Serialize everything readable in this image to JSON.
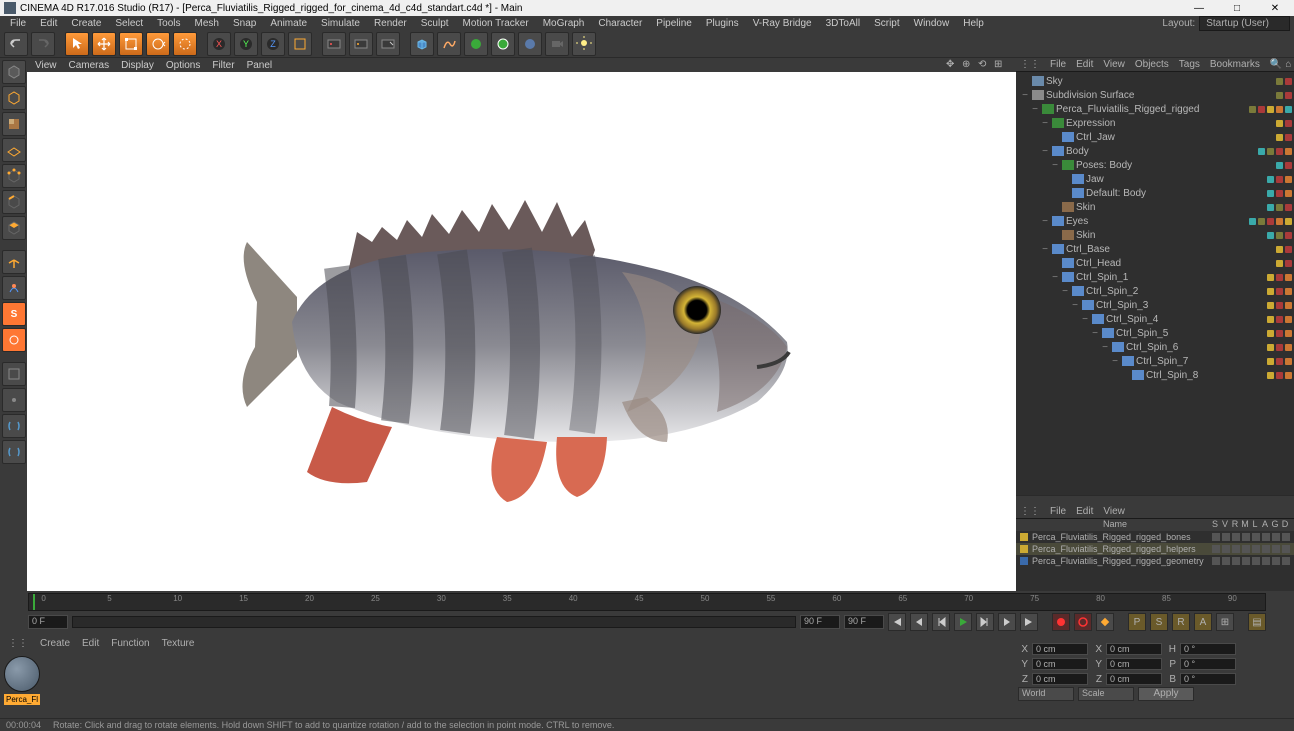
{
  "window": {
    "title": "CINEMA 4D R17.016 Studio (R17) - [Perca_Fluviatilis_Rigged_rigged_for_cinema_4d_c4d_standart.c4d *] - Main",
    "min": "—",
    "max": "□",
    "close": "✕"
  },
  "menu": {
    "items": [
      "File",
      "Edit",
      "Create",
      "Select",
      "Tools",
      "Mesh",
      "Snap",
      "Animate",
      "Simulate",
      "Render",
      "Sculpt",
      "Motion Tracker",
      "MoGraph",
      "Character",
      "Pipeline",
      "Plugins",
      "V-Ray Bridge",
      "3DToAll",
      "Script",
      "Window",
      "Help"
    ],
    "layout_label": "Layout:",
    "layout_value": "Startup (User)"
  },
  "viewport_menu": {
    "items": [
      "View",
      "Cameras",
      "Display",
      "Options",
      "Filter",
      "Panel"
    ]
  },
  "objects_menu": {
    "items": [
      "File",
      "Edit",
      "View",
      "Objects",
      "Tags",
      "Bookmarks"
    ]
  },
  "layers_menu": {
    "items": [
      "File",
      "Edit",
      "View"
    ]
  },
  "layer_header": [
    "Name",
    "S",
    "V",
    "R",
    "M",
    "L",
    "A",
    "G",
    "D"
  ],
  "tree": [
    {
      "d": 0,
      "e": "",
      "i": "ic-sky",
      "n": "Sky",
      "dots": [
        "g",
        "r"
      ]
    },
    {
      "d": 0,
      "e": "−",
      "i": "ic-subd",
      "n": "Subdivision Surface",
      "dots": [
        "g",
        "r"
      ]
    },
    {
      "d": 1,
      "e": "−",
      "i": "ic-null",
      "n": "Perca_Fluviatilis_Rigged_rigged",
      "dots": [
        "g",
        "r",
        "y",
        "o",
        "c"
      ]
    },
    {
      "d": 2,
      "e": "−",
      "i": "ic-null",
      "n": "Expression",
      "dots": [
        "y",
        "r"
      ]
    },
    {
      "d": 3,
      "e": "",
      "i": "ic-joint",
      "n": "Ctrl_Jaw",
      "dots": [
        "y",
        "r"
      ]
    },
    {
      "d": 2,
      "e": "−",
      "i": "ic-joint",
      "n": "Body",
      "dots": [
        "c",
        "g",
        "r",
        "o"
      ]
    },
    {
      "d": 3,
      "e": "−",
      "i": "ic-null",
      "n": "Poses: Body",
      "dots": [
        "c",
        "r"
      ]
    },
    {
      "d": 4,
      "e": "",
      "i": "ic-joint",
      "n": "Jaw",
      "dots": [
        "c",
        "r",
        "o"
      ]
    },
    {
      "d": 4,
      "e": "",
      "i": "ic-joint",
      "n": "Default: Body",
      "dots": [
        "c",
        "r",
        "o"
      ]
    },
    {
      "d": 3,
      "e": "",
      "i": "ic-poly",
      "n": "Skin",
      "dots": [
        "c",
        "g",
        "r"
      ]
    },
    {
      "d": 2,
      "e": "−",
      "i": "ic-joint",
      "n": "Eyes",
      "dots": [
        "c",
        "g",
        "r",
        "o",
        "y"
      ]
    },
    {
      "d": 3,
      "e": "",
      "i": "ic-poly",
      "n": "Skin",
      "dots": [
        "c",
        "g",
        "r"
      ]
    },
    {
      "d": 2,
      "e": "−",
      "i": "ic-joint",
      "n": "Ctrl_Base",
      "dots": [
        "y",
        "r"
      ]
    },
    {
      "d": 3,
      "e": "",
      "i": "ic-joint",
      "n": "Ctrl_Head",
      "dots": [
        "y",
        "r"
      ]
    },
    {
      "d": 3,
      "e": "−",
      "i": "ic-joint",
      "n": "Ctrl_Spin_1",
      "dots": [
        "y",
        "r",
        "o"
      ]
    },
    {
      "d": 4,
      "e": "−",
      "i": "ic-joint",
      "n": "Ctrl_Spin_2",
      "dots": [
        "y",
        "r",
        "o"
      ]
    },
    {
      "d": 5,
      "e": "−",
      "i": "ic-joint",
      "n": "Ctrl_Spin_3",
      "dots": [
        "y",
        "r",
        "o"
      ]
    },
    {
      "d": 6,
      "e": "−",
      "i": "ic-joint",
      "n": "Ctrl_Spin_4",
      "dots": [
        "y",
        "r",
        "o"
      ]
    },
    {
      "d": 7,
      "e": "−",
      "i": "ic-joint",
      "n": "Ctrl_Spin_5",
      "dots": [
        "y",
        "r",
        "o"
      ]
    },
    {
      "d": 8,
      "e": "−",
      "i": "ic-joint",
      "n": "Ctrl_Spin_6",
      "dots": [
        "y",
        "r",
        "o"
      ]
    },
    {
      "d": 9,
      "e": "−",
      "i": "ic-joint",
      "n": "Ctrl_Spin_7",
      "dots": [
        "y",
        "r",
        "o"
      ]
    },
    {
      "d": 10,
      "e": "",
      "i": "ic-joint",
      "n": "Ctrl_Spin_8",
      "dots": [
        "y",
        "r",
        "o"
      ]
    }
  ],
  "layers": [
    {
      "c": "#ccaa33",
      "n": "Perca_Fluviatilis_Rigged_rigged_bones",
      "hl": false
    },
    {
      "c": "#ccaa33",
      "n": "Perca_Fluviatilis_Rigged_rigged_helpers",
      "hl": true
    },
    {
      "c": "#3a6aaa",
      "n": "Perca_Fluviatilis_Rigged_rigged_geometry",
      "hl": false
    }
  ],
  "timeline": {
    "ticks": [
      "0",
      "5",
      "10",
      "15",
      "20",
      "25",
      "30",
      "35",
      "40",
      "45",
      "50",
      "55",
      "60",
      "65",
      "70",
      "75",
      "80",
      "85",
      "90"
    ],
    "end_label": "0 F",
    "frame_start": "0 F",
    "frame_end_a": "90 F",
    "frame_end_b": "90 F"
  },
  "materials": {
    "menu": [
      "Create",
      "Edit",
      "Function",
      "Texture"
    ],
    "thumb_label": "Perca_Fl"
  },
  "coords": {
    "x": "0 cm",
    "y": "0 cm",
    "z": "0 cm",
    "sx": "0 cm",
    "sy": "0 cm",
    "sz": "0 cm",
    "h": "0 °",
    "p": "0 °",
    "b": "0 °",
    "mode_a": "World",
    "mode_b": "Scale",
    "apply": "Apply"
  },
  "status": {
    "time": "00:00:04",
    "hint": "Rotate: Click and drag to rotate elements. Hold down SHIFT to add to quantize rotation / add to the selection in point mode. CTRL to remove."
  }
}
